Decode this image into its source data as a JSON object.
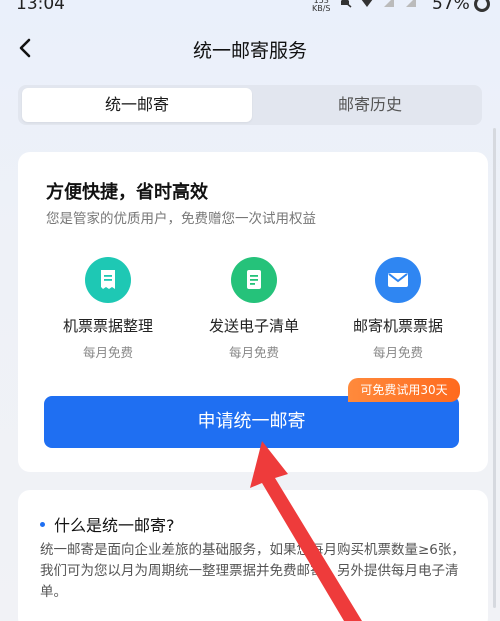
{
  "status_bar": {
    "time": "13:04",
    "net_speed_value": "153",
    "net_speed_unit": "KB/S",
    "battery": "57%"
  },
  "nav": {
    "title": "统一邮寄服务",
    "back_icon": "chevron-left-icon"
  },
  "tabs": [
    {
      "label": "统一邮寄",
      "active": true
    },
    {
      "label": "邮寄历史",
      "active": false
    }
  ],
  "main_card": {
    "heading": "方便快捷，省时高效",
    "subtitle": "您是管家的优质用户，免费赠您一次试用权益",
    "features": [
      {
        "label": "机票票据整理",
        "note": "每月免费",
        "icon": "receipt-icon",
        "color": "#1ec8b4"
      },
      {
        "label": "发送电子清单",
        "note": "每月免费",
        "icon": "document-icon",
        "color": "#25c27a"
      },
      {
        "label": "邮寄机票票据",
        "note": "每月免费",
        "icon": "mail-icon",
        "color": "#2f86f2"
      }
    ],
    "apply_button": "申请统一邮寄",
    "trial_badge": "可免费试用30天"
  },
  "info_card": {
    "title": "什么是统一邮寄?",
    "body": "统一邮寄是面向企业差旅的基础服务，如果您每月购买机票数量≥6张，我们可为您以月为周期统一整理票据并免费邮寄；另外提供每月电子清单。"
  },
  "colors": {
    "accent": "#1f6ff2",
    "badge": "#ff7a2a",
    "annotation_arrow": "#ee3b3b"
  }
}
